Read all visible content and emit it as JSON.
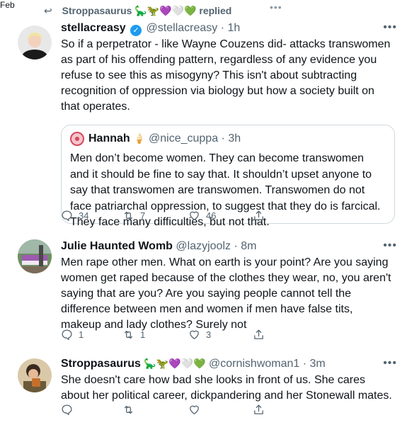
{
  "top": {
    "month_label": "Feb",
    "dots": "•••",
    "replied_name": "Stroppasaurus",
    "replied_text": "replied",
    "replied_emoji": "🦕🦖💜🤍💚"
  },
  "tweets": [
    {
      "name": "stellacreasy",
      "handle": "@stellacreasy",
      "time": "· 1h",
      "body": "So if a perpetrator - like Wayne Couzens did- attacks transwomen as part of his offending pattern, regardless of any evidence you refuse to see this as misogyny? This isn't about subtracting recognition of oppression via biology but how a society built on that operates.",
      "quote": {
        "name": "Hannah",
        "emoji": "🍦",
        "handle": "@nice_cuppa",
        "time": "· 3h",
        "body": "Men don’t become women. They can become transwomen and it should be fine to say that. It shouldn’t upset anyone to say that transwomen are transwomen. Transwomen do not face patriarchal oppression, to suggest that they do is farcical. They face many difficulties, but not that."
      },
      "actions": {
        "replies": "34",
        "retweets": "7",
        "likes": "46"
      }
    },
    {
      "name": "Julie Haunted Womb",
      "handle": "@lazyjoolz",
      "time": "· 8m",
      "body": "Men rape other men. What on earth is your point? Are you saying women get raped because of the clothes they wear, no, you aren't saying that are you? Are you saying people cannot tell the difference between men and women if men have false tits, makeup and lady clothes? Surely not",
      "actions": {
        "replies": "1",
        "retweets": "1",
        "likes": "3"
      }
    },
    {
      "name": "Stroppasaurus",
      "emoji": "🦕🦖💜🤍💚",
      "handle": "@cornishwoman1",
      "time": "· 3m",
      "body": "She doesn't care how bad she looks in front of us. She cares about her political career, dickpandering and her Stonewall mates.",
      "actions": {
        "replies": "",
        "retweets": "",
        "likes": ""
      }
    }
  ],
  "more_label": "•••",
  "colors": {
    "accent": "#1d9bf0",
    "muted": "#536471",
    "border": "#cfd9de"
  }
}
